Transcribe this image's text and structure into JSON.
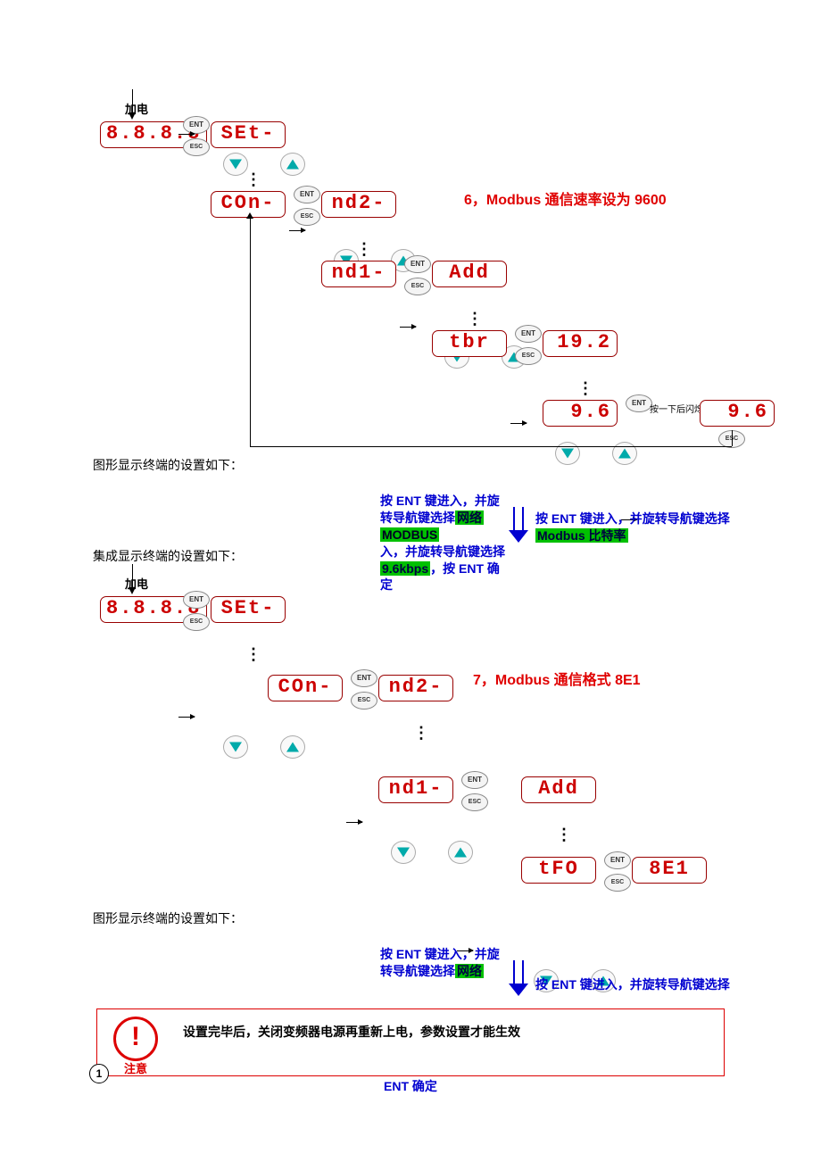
{
  "labels": {
    "power_on": "加电",
    "ent": "ENT",
    "esc": "ESC",
    "press_note": "按一下后闪烁"
  },
  "section6": {
    "title": "6，Modbus 通信速率设为 9600",
    "graphic_caption": "图形显示终端的设置如下：",
    "integrated_caption": "集成显示终端的设置如下：",
    "displays": {
      "d0": "8.8.8.8",
      "d1": "SEt-",
      "d2": "COn-",
      "d3": "nd2-",
      "d4": "nd1-",
      "d5": "Add",
      "d6": "tbr",
      "d7": "19.2",
      "d8a": "9.6",
      "d8b": "9.6"
    },
    "instructions": {
      "left_part1": "按 ENT 键进入，并旋转导航键选择",
      "left_hl1": "网络",
      "left_hl2": "MODBUS",
      "left_part2": "入，并旋转导航键选择",
      "left_hl3": "9.6kbps",
      "left_part3": "，按 ENT 确定",
      "right_part1": "按 ENT 键进入，并旋转导航键选择",
      "right_hl1": "Modbus 比特率"
    }
  },
  "section7": {
    "title": "7，Modbus 通信格式 8E1",
    "graphic_caption": "图形显示终端的设置如下：",
    "displays": {
      "d0": "8.8.8.8",
      "d1": "SEt-",
      "d2": "COn-",
      "d3": "nd2-",
      "d4": "nd1-",
      "d5": "Add",
      "d6": "tFO",
      "d7": "8E1"
    },
    "instructions": {
      "left_part1": "按 ENT 键进入，并旋转导航键选择",
      "left_hl1": "网络",
      "right_part1": "按 ENT 键进入，并旋转导航键选择"
    }
  },
  "note": {
    "text": "设置完毕后，关闭变频器电源再重新上电，参数设置才能生效",
    "label": "注意"
  },
  "page_number": "1",
  "cutoff": "ENT 确定"
}
